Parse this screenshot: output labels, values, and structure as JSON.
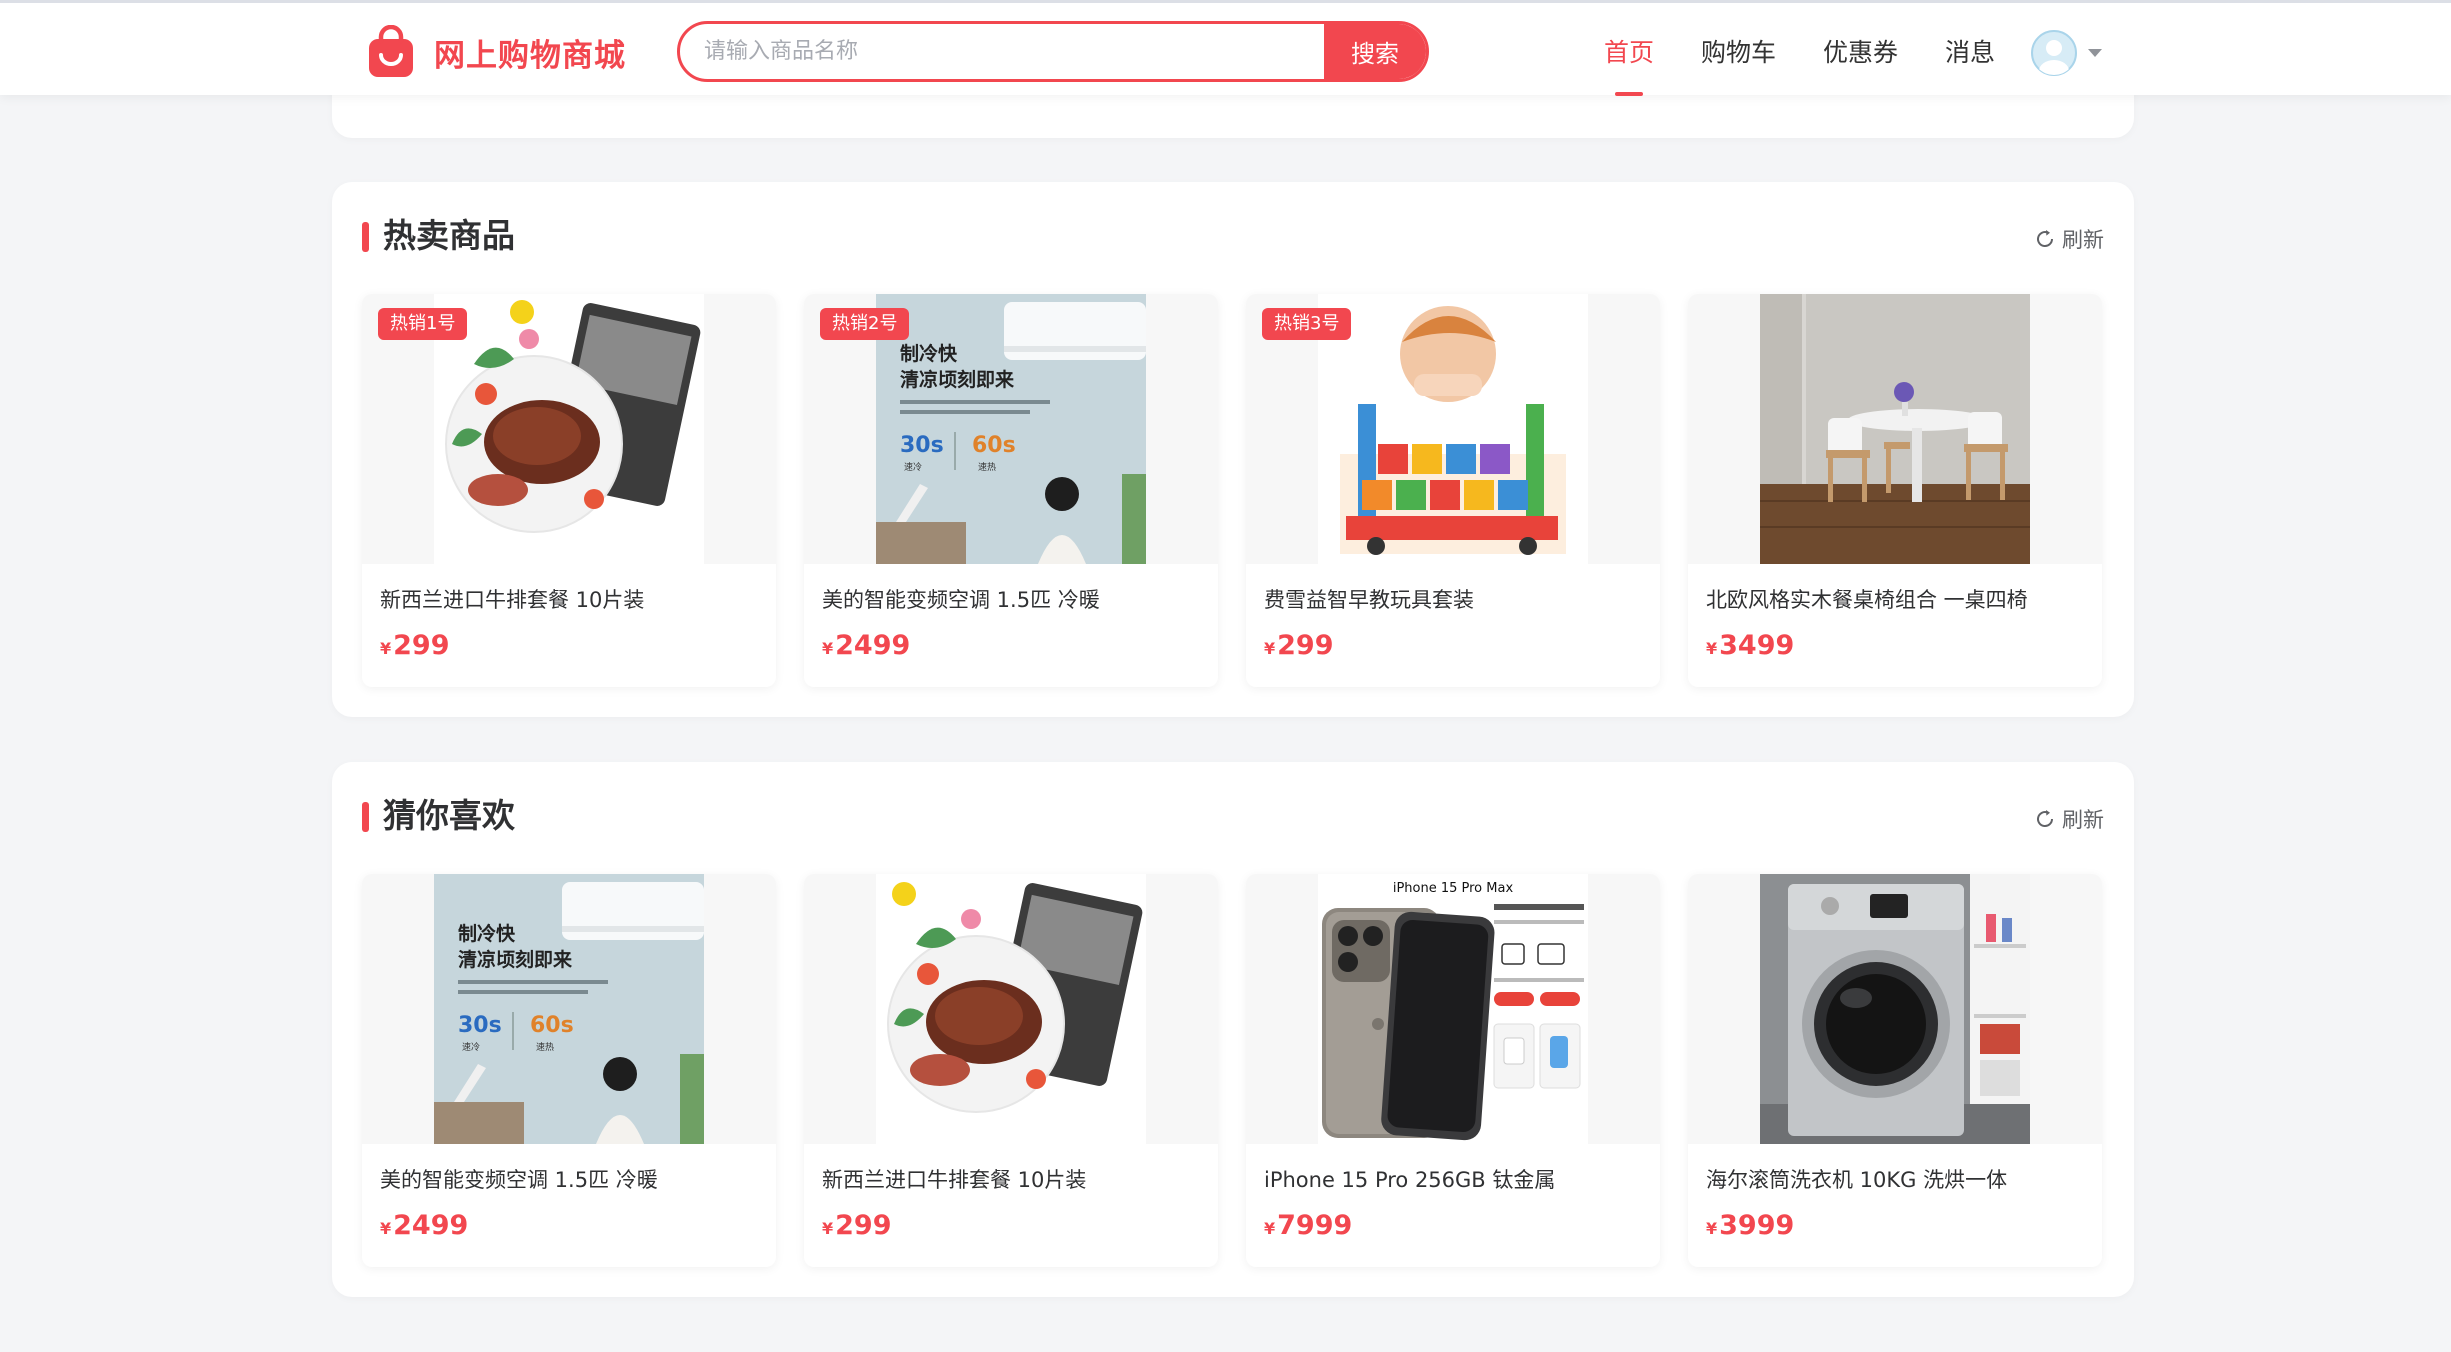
{
  "header": {
    "brand": "网上购物商城",
    "search_placeholder": "请输入商品名称",
    "search_button": "搜索",
    "nav": [
      {
        "label": "首页",
        "active": true
      },
      {
        "label": "购物车",
        "active": false
      },
      {
        "label": "优惠券",
        "active": false
      },
      {
        "label": "消息",
        "active": false
      }
    ]
  },
  "hot": {
    "title": "热卖商品",
    "refresh": "刷新",
    "products": [
      {
        "badge": "热销1号",
        "name": "新西兰进口牛排套餐 10片装",
        "currency": "¥",
        "price": "299",
        "image": "steak"
      },
      {
        "badge": "热销2号",
        "name": "美的智能变频空调 1.5匹 冷暖",
        "currency": "¥",
        "price": "2499",
        "image": "aircon"
      },
      {
        "badge": "热销3号",
        "name": "费雪益智早教玩具套装",
        "currency": "¥",
        "price": "299",
        "image": "toys"
      },
      {
        "badge": "",
        "name": "北欧风格实木餐桌椅组合 一桌四椅",
        "currency": "¥",
        "price": "3499",
        "image": "table"
      }
    ]
  },
  "like": {
    "title": "猜你喜欢",
    "refresh": "刷新",
    "products": [
      {
        "name": "美的智能变频空调 1.5匹 冷暖",
        "currency": "¥",
        "price": "2499",
        "image": "aircon"
      },
      {
        "name": "新西兰进口牛排套餐 10片装",
        "currency": "¥",
        "price": "299",
        "image": "steak"
      },
      {
        "name": "iPhone 15 Pro 256GB 钛金属",
        "currency": "¥",
        "price": "7999",
        "image": "iphone"
      },
      {
        "name": "海尔滚筒洗衣机 10KG 洗烘一体",
        "currency": "¥",
        "price": "3999",
        "image": "washer"
      }
    ]
  },
  "art_text": {
    "aircon_headline_1": "制冷快",
    "aircon_headline_2": "清凉顷刻即来",
    "aircon_fast": "30s",
    "aircon_fast_label": "速冷",
    "aircon_hot": "60s",
    "aircon_hot_label": "速热",
    "iphone_title": "iPhone 15 Pro Max"
  },
  "colors": {
    "accent": "#f2474f",
    "page_bg": "#f4f5f7"
  }
}
